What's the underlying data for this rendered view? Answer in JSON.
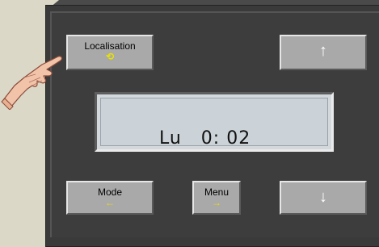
{
  "buttons": {
    "localisation": {
      "label": "Localisation",
      "icon": "⟲"
    },
    "up": {
      "icon": "↑"
    },
    "mode": {
      "label": "Mode",
      "icon": "←"
    },
    "menu": {
      "label": "Menu",
      "icon": "→"
    },
    "down": {
      "icon": "↓"
    }
  },
  "display": {
    "text": "Lu   0: 02"
  },
  "colors": {
    "background": "#dcd8c8",
    "panel": "#3a3a3a",
    "button": "#a9a9a9",
    "lcd": "#ccd3d8",
    "accent_arrow": "#e8e000"
  },
  "icons": {
    "hand": "pointing-hand-icon"
  }
}
